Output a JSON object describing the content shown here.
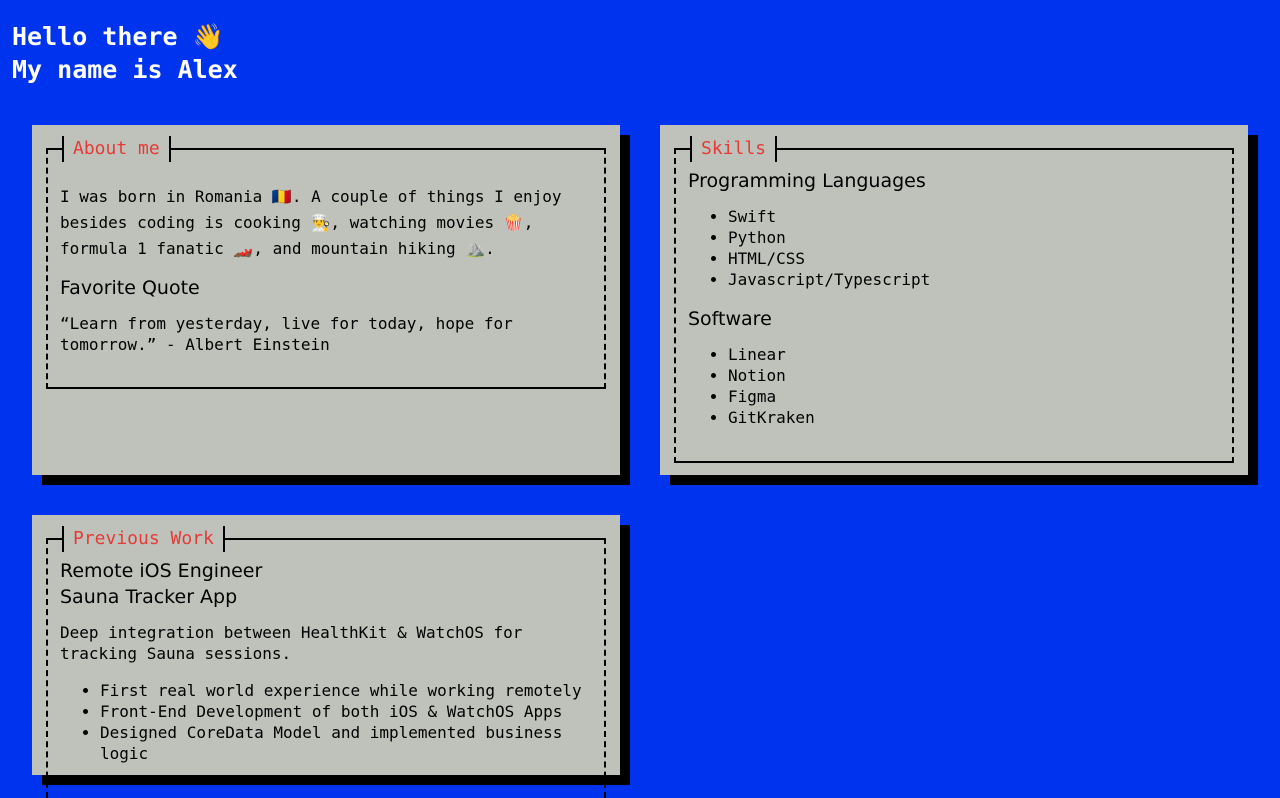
{
  "header": {
    "line1": "Hello there 👋",
    "line2": "My name is Alex"
  },
  "about": {
    "title": "About me",
    "intro": "I was born in Romania 🇷🇴. A couple of things I enjoy besides coding is cooking 👨‍🍳, watching movies 🍿, formula 1 fanatic 🏎️, and mountain hiking ⛰️.",
    "quote_heading": "Favorite Quote",
    "quote": "“Learn from yesterday, live for today, hope for tomorrow.” - Albert Einstein"
  },
  "skills": {
    "title": "Skills",
    "languages_heading": "Programming Languages",
    "languages": [
      "Swift",
      "Python",
      "HTML/CSS",
      "Javascript/Typescript"
    ],
    "software_heading": "Software",
    "software": [
      "Linear",
      "Notion",
      "Figma",
      "GitKraken"
    ]
  },
  "work": {
    "title": "Previous Work",
    "role": "Remote iOS Engineer",
    "project": "Sauna Tracker App",
    "description": "Deep integration between HealthKit & WatchOS for tracking Sauna sessions.",
    "highlights": [
      "First real world experience while working remotely",
      "Front-End Development of both iOS & WatchOS Apps",
      "Designed CoreData Model and implemented business logic"
    ]
  },
  "colors": {
    "background": "#0033ee",
    "card": "#bfc1bb",
    "title_accent": "#e53b36"
  }
}
